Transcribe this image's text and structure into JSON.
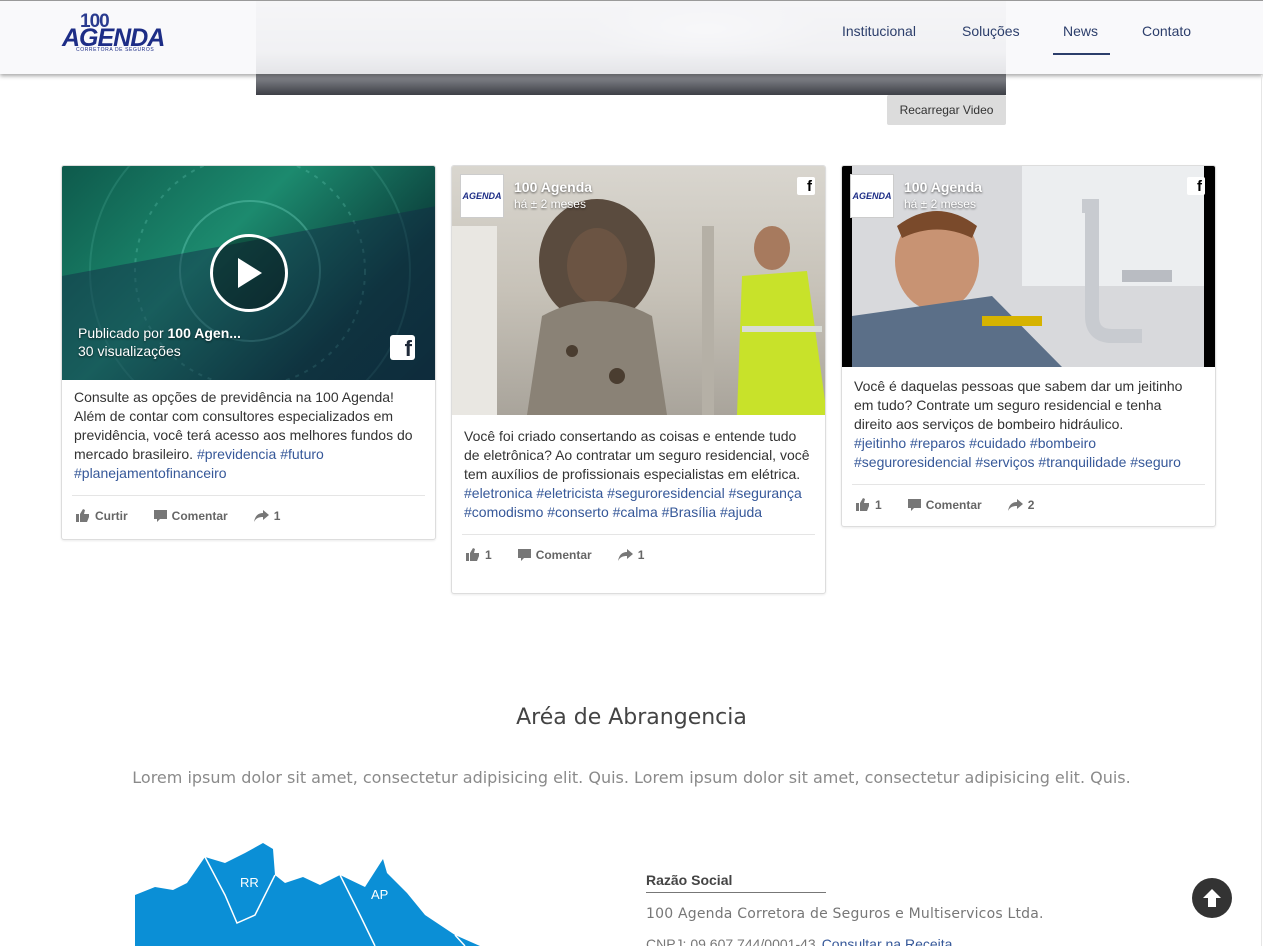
{
  "header": {
    "logo": {
      "number": "100",
      "word": "AGENDA",
      "tagline": "CORRETORA DE SEGUROS"
    },
    "nav": [
      {
        "label": "Institucional",
        "active": false
      },
      {
        "label": "Soluções",
        "active": false
      },
      {
        "label": "News",
        "active": true
      },
      {
        "label": "Contato",
        "active": false
      }
    ]
  },
  "video": {
    "reload_label": "Recarregar Video"
  },
  "posts": [
    {
      "published_prefix": "Publicado por ",
      "published_by": "100 Agen...",
      "views": "30 visualizações",
      "body": "Consulte as opções de previdência na 100 Agenda! Além de contar com consultores especializados em previdência, você terá acesso aos melhores fundos do mercado brasileiro. ",
      "tags": "#previdencia #futuro #planejamentofinanceiro",
      "like_label": "Curtir",
      "comment_label": "Comentar",
      "share_count": "1"
    },
    {
      "page_name": "100 Agenda",
      "time": "há ± 2 meses",
      "body": "Você foi criado consertando as coisas e entende tudo de eletrônica? Ao contratar um seguro residencial, você tem auxílios de profissionais especialistas em elétrica.",
      "tags": "#eletronica #eletricista #seguroresidencial #segurança #comodismo #conserto #calma #Brasília #ajuda",
      "like_count": "1",
      "comment_label": "Comentar",
      "share_count": "1"
    },
    {
      "page_name": "100 Agenda",
      "time": "há ± 2 meses",
      "body": "Você é daquelas pessoas que sabem dar um jeitinho em tudo? Contrate um seguro residencial e tenha direito aos serviços de bombeiro hidráulico.",
      "tags": "#jeitinho #reparos #cuidado #bombeiro #seguroresidencial #serviços #tranquilidade #seguro",
      "like_count": "1",
      "comment_label": "Comentar",
      "share_count": "2"
    }
  ],
  "coverage": {
    "title": "Aréa de Abrangencia",
    "subtitle": "Lorem ipsum dolor sit amet, consectetur adipisicing elit. Quis. Lorem ipsum dolor sit amet, consectetur adipisicing elit. Quis.",
    "map_labels": [
      "RR",
      "AP"
    ],
    "razao_label": "Razão Social",
    "razao_value": "100 Agenda Corretora de Seguros e Multiservicos Ltda.",
    "cnpj": "CNPJ: 09.607.744/0001-43",
    "cnpj_link": "Consultar na Receita"
  },
  "colors": {
    "link": "#365899",
    "nav": "#2c3e6b",
    "map": "#0b8fd6"
  },
  "icons": [
    "play-icon",
    "facebook-icon",
    "like-icon",
    "comment-icon",
    "share-icon",
    "arrow-up-icon"
  ]
}
